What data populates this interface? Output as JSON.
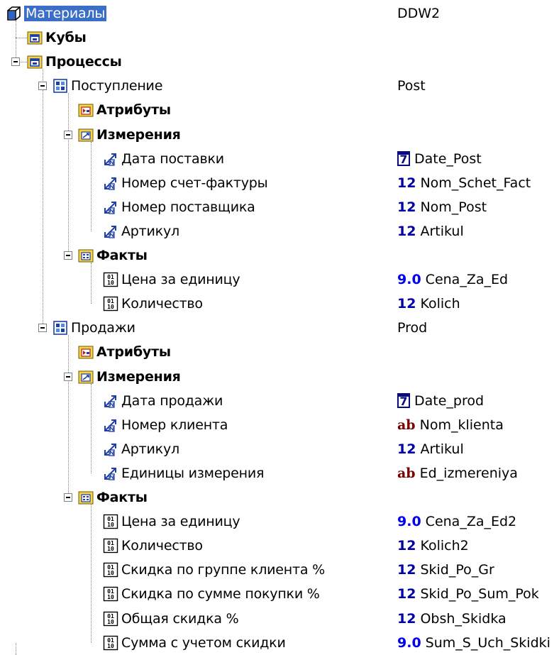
{
  "tree": [
    {
      "id": "root",
      "label": "Материалы",
      "value": "DDW2",
      "icon": "cube-icon",
      "level": 0,
      "selected": true
    },
    {
      "id": "cubes",
      "label": "Кубы",
      "icon": "folder-cube-icon",
      "level": 1,
      "bold": true
    },
    {
      "id": "processes",
      "label": "Процессы",
      "icon": "folder-cube-icon",
      "level": 1,
      "bold": true,
      "expanded": true
    },
    {
      "id": "postuplenie",
      "label": "Поступление",
      "value": "Post",
      "icon": "process-icon",
      "level": 2,
      "expanded": true
    },
    {
      "id": "post-attr",
      "label": "Атрибуты",
      "icon": "folder-attributes-icon",
      "level": 3,
      "bold": true
    },
    {
      "id": "post-dims",
      "label": "Измерения",
      "icon": "folder-dimensions-icon",
      "level": 3,
      "bold": true,
      "expanded": true
    },
    {
      "id": "post-dim1",
      "label": "Дата поставки",
      "type": "7",
      "value": "Date_Post",
      "icon": "dimension-icon",
      "level": 4
    },
    {
      "id": "post-dim2",
      "label": "Номер счет-фактуры",
      "type": "12",
      "value": "Nom_Schet_Fact",
      "icon": "dimension-icon",
      "level": 4
    },
    {
      "id": "post-dim3",
      "label": "Номер поставщика",
      "type": "12",
      "value": "Nom_Post",
      "icon": "dimension-icon",
      "level": 4
    },
    {
      "id": "post-dim4",
      "label": "Артикул",
      "type": "12",
      "value": "Artikul",
      "icon": "dimension-icon",
      "level": 4
    },
    {
      "id": "post-facts",
      "label": "Факты",
      "icon": "folder-facts-icon",
      "level": 3,
      "bold": true,
      "expanded": true
    },
    {
      "id": "post-fact1",
      "label": "Цена за единицу",
      "type": "9.0",
      "value": "Cena_Za_Ed",
      "icon": "fact-icon",
      "level": 4
    },
    {
      "id": "post-fact2",
      "label": "Количество",
      "type": "12",
      "value": "Kolich",
      "icon": "fact-icon",
      "level": 4
    },
    {
      "id": "prodazhi",
      "label": "Продажи",
      "value": "Prod",
      "icon": "process-icon",
      "level": 2,
      "expanded": true
    },
    {
      "id": "prod-attr",
      "label": "Атрибуты",
      "icon": "folder-attributes-icon",
      "level": 3,
      "bold": true
    },
    {
      "id": "prod-dims",
      "label": "Измерения",
      "icon": "folder-dimensions-icon",
      "level": 3,
      "bold": true,
      "expanded": true
    },
    {
      "id": "prod-dim1",
      "label": "Дата продажи",
      "type": "7",
      "value": "Date_prod",
      "icon": "dimension-icon",
      "level": 4
    },
    {
      "id": "prod-dim2",
      "label": "Номер клиента",
      "type": "ab",
      "value": "Nom_klienta",
      "icon": "dimension-icon",
      "level": 4
    },
    {
      "id": "prod-dim3",
      "label": "Артикул",
      "type": "12",
      "value": "Artikul",
      "icon": "dimension-icon",
      "level": 4
    },
    {
      "id": "prod-dim4",
      "label": "Единицы измерения",
      "type": "ab",
      "value": "Ed_izmereniya",
      "icon": "dimension-icon",
      "level": 4
    },
    {
      "id": "prod-facts",
      "label": "Факты",
      "icon": "folder-facts-icon",
      "level": 3,
      "bold": true,
      "expanded": true
    },
    {
      "id": "prod-fact1",
      "label": "Цена за единицу",
      "type": "9.0",
      "value": "Cena_Za_Ed2",
      "icon": "fact-icon",
      "level": 4
    },
    {
      "id": "prod-fact2",
      "label": "Количество",
      "type": "12",
      "value": "Kolich2",
      "icon": "fact-icon",
      "level": 4
    },
    {
      "id": "prod-fact3",
      "label": "Скидка по группе клиента %",
      "type": "12",
      "value": "Skid_Po_Gr",
      "icon": "fact-icon",
      "level": 4
    },
    {
      "id": "prod-fact4",
      "label": "Скидка по сумме покупки %",
      "type": "12",
      "value": "Skid_Po_Sum_Pok",
      "icon": "fact-icon",
      "level": 4
    },
    {
      "id": "prod-fact5",
      "label": "Общая скидка %",
      "type": "12",
      "value": "Obsh_Skidka",
      "icon": "fact-icon",
      "level": 4
    },
    {
      "id": "prod-fact6",
      "label": "Сумма с учетом скидки",
      "type": "9.0",
      "value": "Sum_S_Uch_Skidki",
      "icon": "fact-icon",
      "level": 4
    }
  ],
  "colors": {
    "selection": "#3a6ec7",
    "folder": "#f5d44a",
    "icon_blue": "#1f3fa8",
    "type_numeric": "#0000a8",
    "type_text": "#7a0000"
  }
}
